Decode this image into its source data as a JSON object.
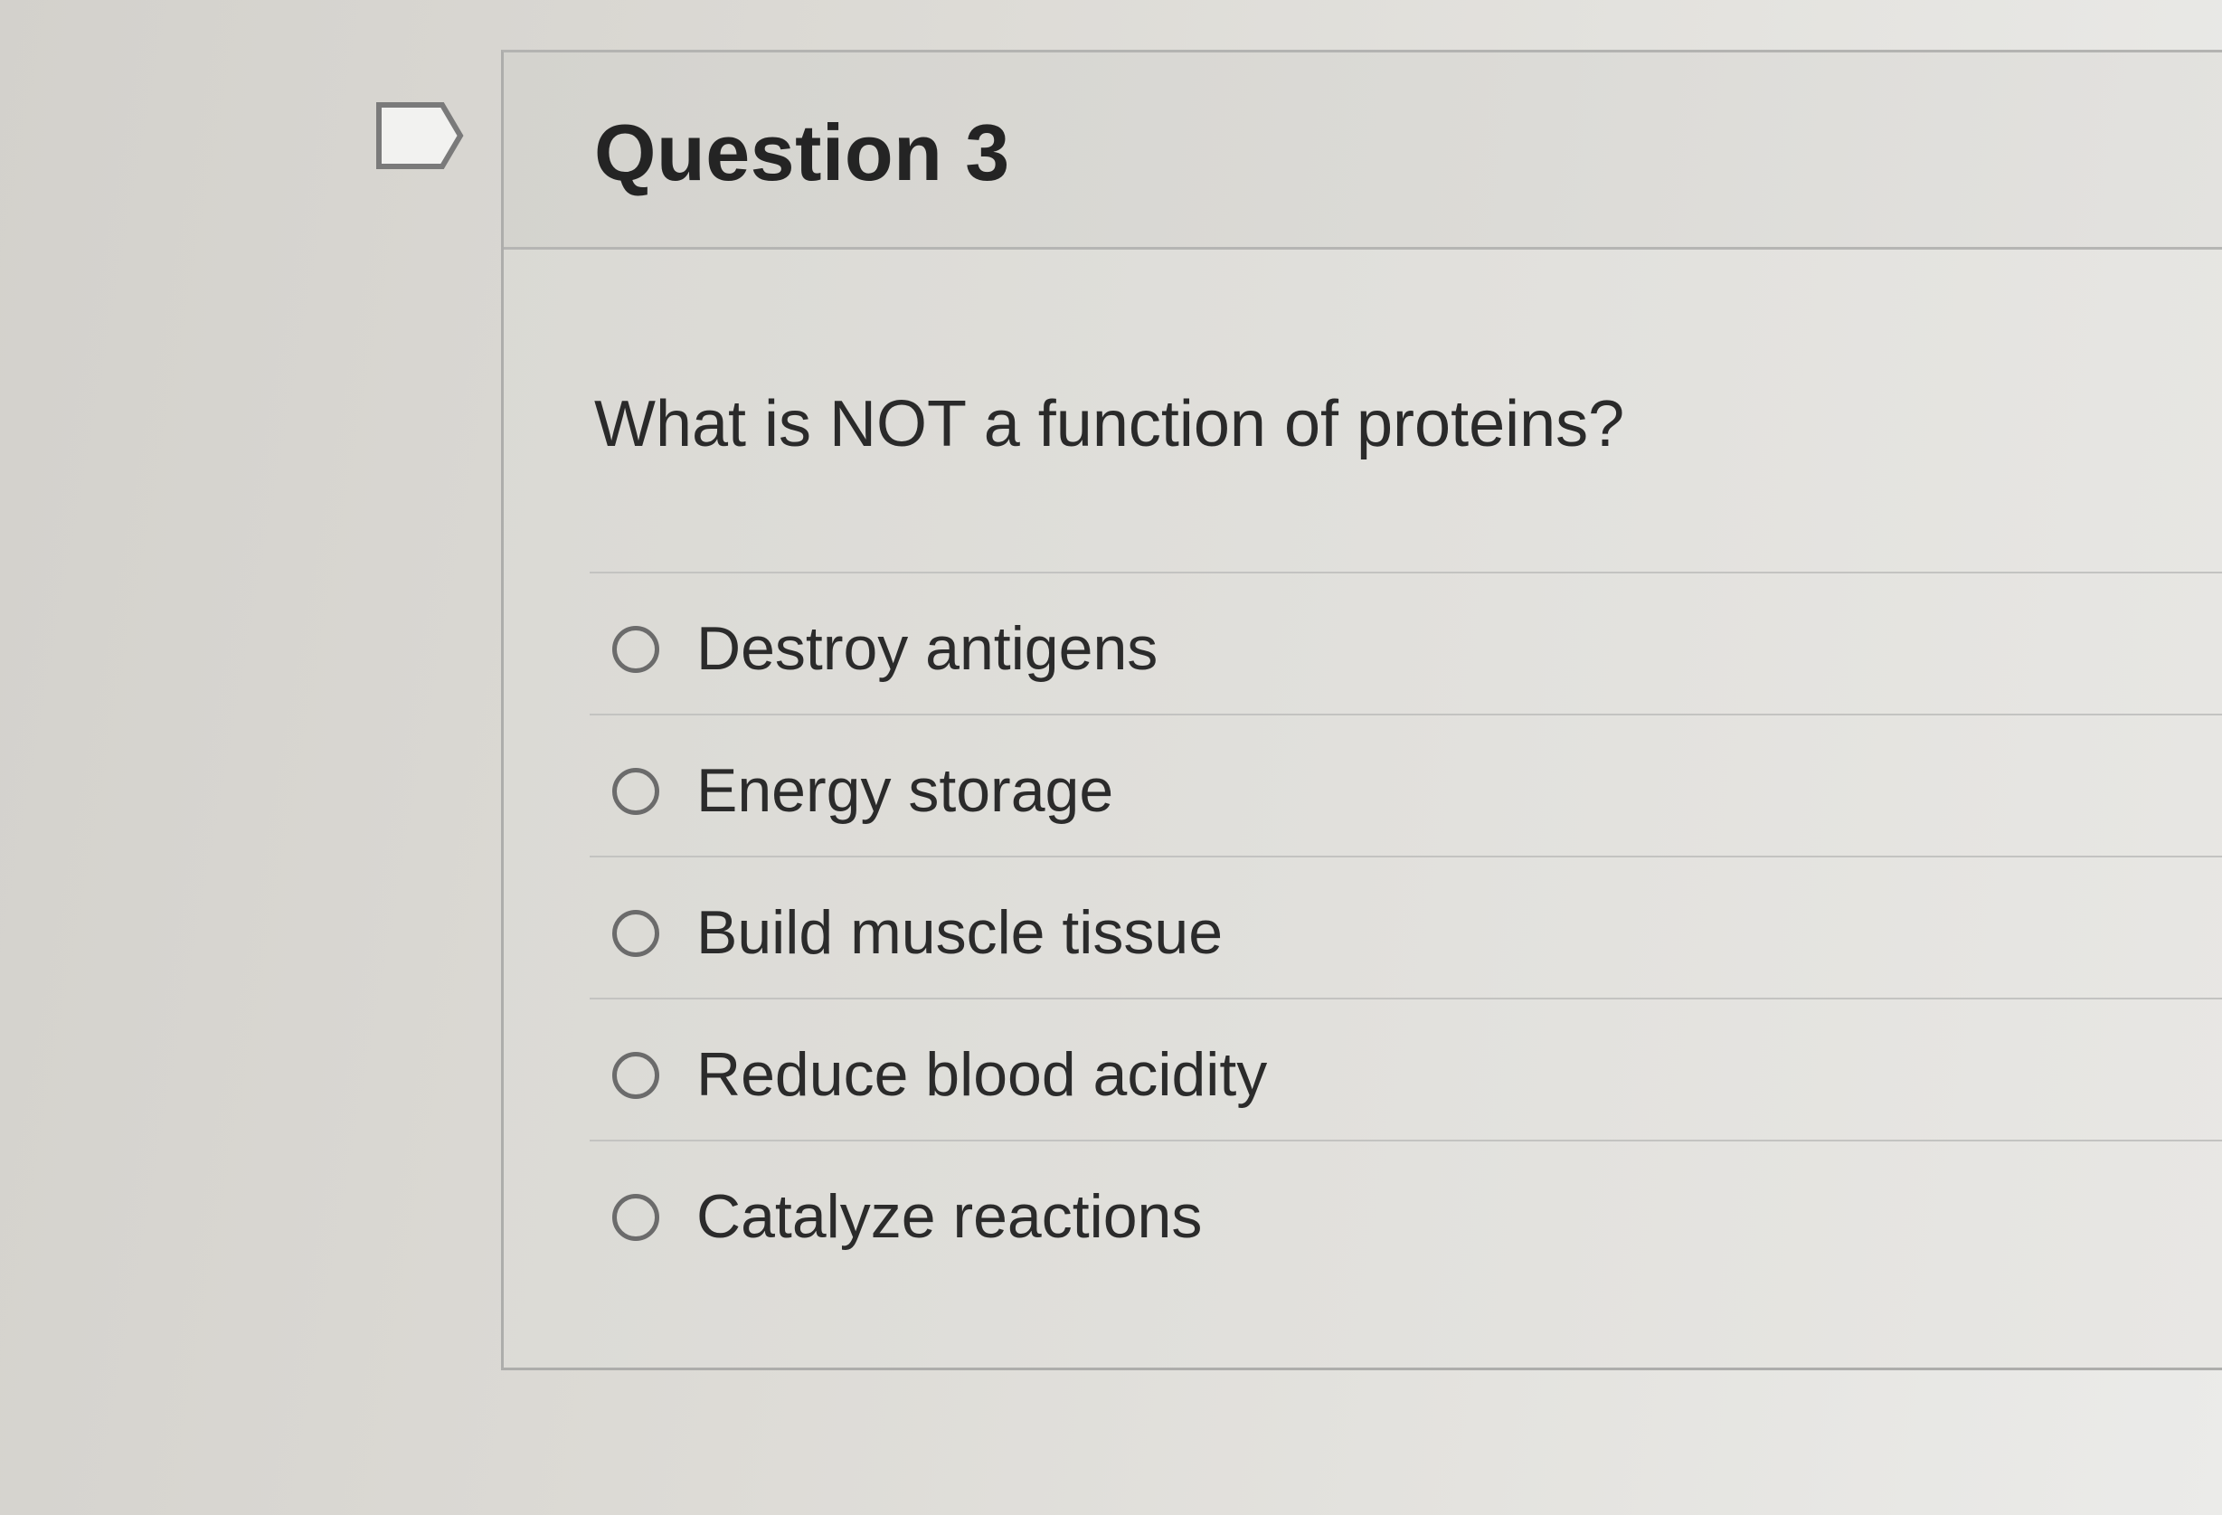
{
  "question": {
    "title": "Question 3",
    "prompt": "What is NOT a function of proteins?",
    "flag_icon": "flag-icon"
  },
  "answers": [
    {
      "label": "Destroy antigens",
      "selected": false
    },
    {
      "label": "Energy storage",
      "selected": false
    },
    {
      "label": "Build muscle tissue",
      "selected": false
    },
    {
      "label": "Reduce blood acidity",
      "selected": false
    },
    {
      "label": "Catalyze reactions",
      "selected": false
    }
  ],
  "colors": {
    "border": "#adadab",
    "text": "#262626",
    "radio": "#6b6b6b"
  }
}
